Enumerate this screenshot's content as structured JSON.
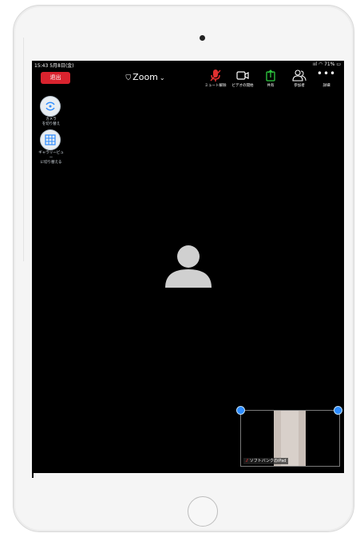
{
  "status_bar": {
    "time": "15:43 5月8日(金)",
    "right": "ııl ◠ 71% ▭"
  },
  "toolbar": {
    "leave_label": "退出",
    "meeting_title": "Zoom",
    "shield_icon": "shield-icon",
    "items": [
      {
        "name": "mute",
        "label": "ミュート解除",
        "icon": "microphone-muted-icon"
      },
      {
        "name": "video",
        "label": "ビデオの開始",
        "icon": "video-camera-icon"
      },
      {
        "name": "share",
        "label": "共有",
        "icon": "share-icon"
      },
      {
        "name": "participants",
        "label": "参加者",
        "icon": "participants-icon"
      },
      {
        "name": "more",
        "label": "詳細",
        "icon": "more-icon"
      }
    ]
  },
  "left_controls": {
    "camera_switch_label": "カメラ\nを切り替え",
    "gallery_label": "ギャラリービュ\nー\nに切り替える"
  },
  "self_view": {
    "name": "ソフトバンクのiPad"
  },
  "colors": {
    "leave": "#d9232e",
    "screen": "#000000",
    "accent": "#2d8cff",
    "share": "#2ecc40",
    "muted": "#e03030"
  }
}
